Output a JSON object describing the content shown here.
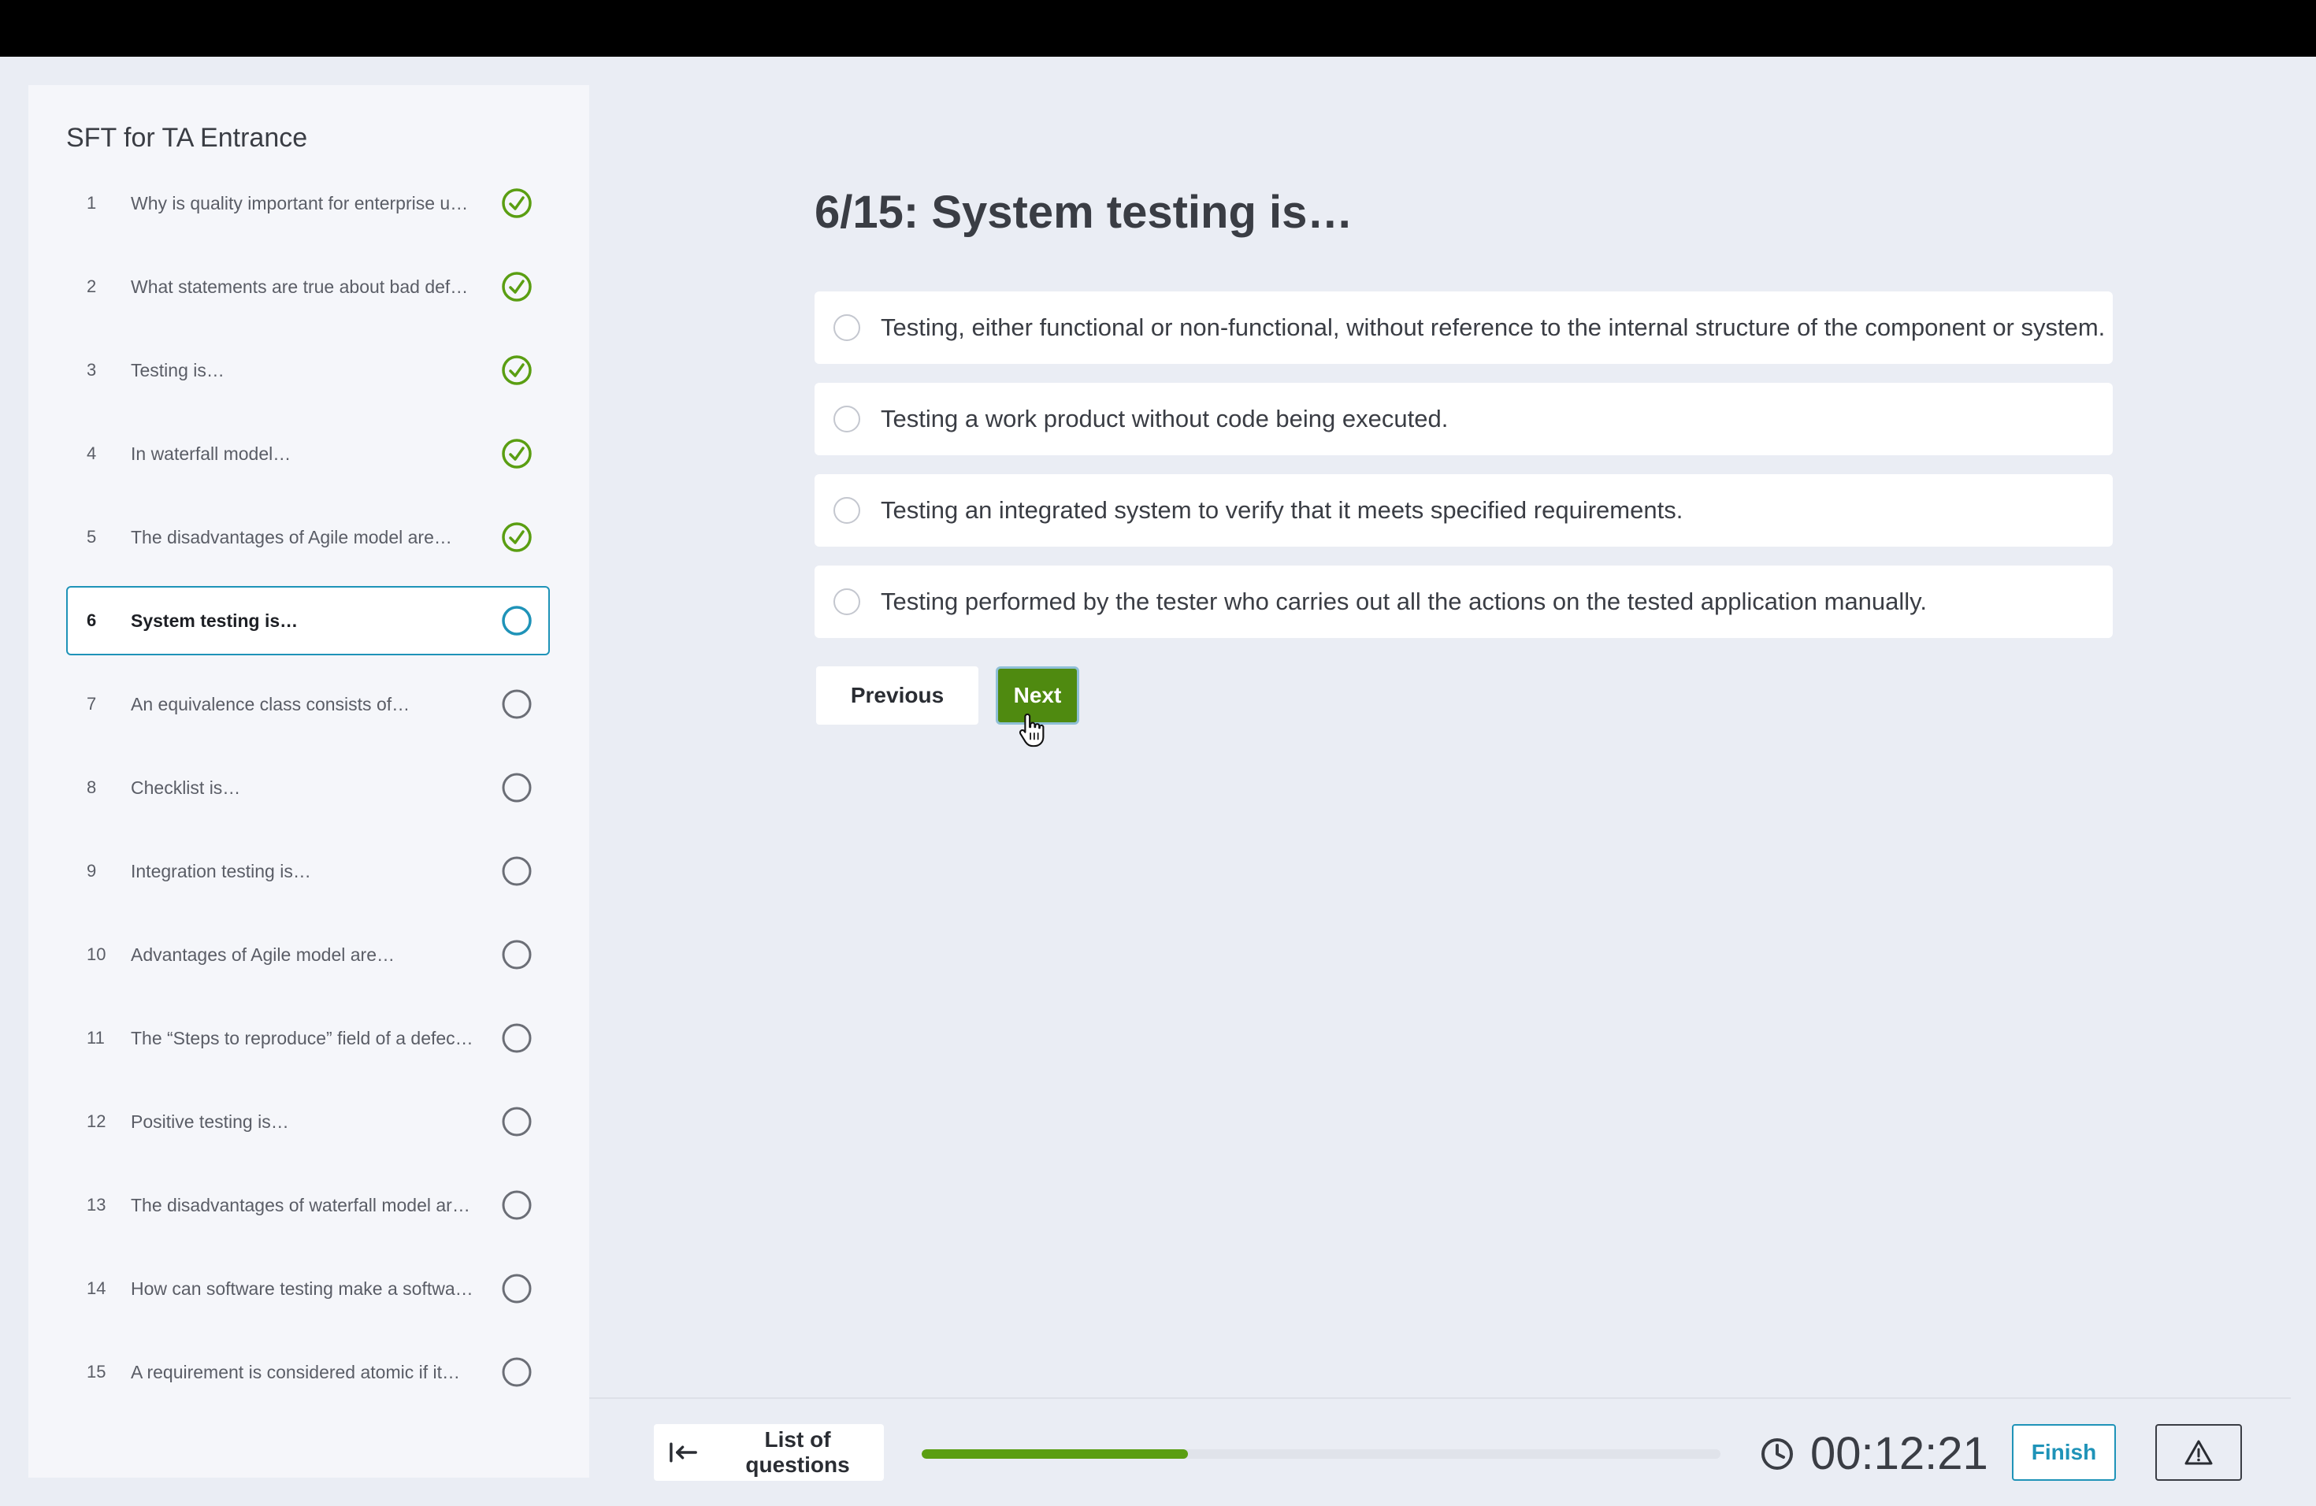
{
  "sidebar": {
    "title": "SFT for TA Entrance",
    "questions": [
      {
        "num": "1",
        "text": "Why is quality important for enterprise u…",
        "status": "answered"
      },
      {
        "num": "2",
        "text": "What statements are true about bad defe…",
        "status": "answered"
      },
      {
        "num": "3",
        "text": "Testing is…",
        "status": "answered"
      },
      {
        "num": "4",
        "text": "In waterfall model…",
        "status": "answered"
      },
      {
        "num": "5",
        "text": "The disadvantages of Agile model are…",
        "status": "answered"
      },
      {
        "num": "6",
        "text": "System testing is…",
        "status": "current"
      },
      {
        "num": "7",
        "text": "An equivalence class consists of…",
        "status": "unanswered"
      },
      {
        "num": "8",
        "text": "Checklist is…",
        "status": "unanswered"
      },
      {
        "num": "9",
        "text": "Integration testing is…",
        "status": "unanswered"
      },
      {
        "num": "10",
        "text": "Advantages of Agile model are…",
        "status": "unanswered"
      },
      {
        "num": "11",
        "text": "The “Steps to reproduce” field of a defec…",
        "status": "unanswered"
      },
      {
        "num": "12",
        "text": "Positive testing is…",
        "status": "unanswered"
      },
      {
        "num": "13",
        "text": "The disadvantages of waterfall model ar…",
        "status": "unanswered"
      },
      {
        "num": "14",
        "text": "How can software testing make a softwar…",
        "status": "unanswered"
      },
      {
        "num": "15",
        "text": "A requirement is considered atomic if it…",
        "status": "unanswered"
      }
    ]
  },
  "question": {
    "title": "6/15: System testing is…",
    "answers": [
      "Testing, either functional or non-functional, without reference to the internal structure of the component or system.",
      "Testing a work product without code being executed.",
      "Testing an integrated system to verify that it meets specified requirements.",
      "Testing performed by the tester who carries out all the actions on the tested application manually."
    ],
    "previous_label": "Previous",
    "next_label": "Next"
  },
  "footer": {
    "list_label": "List of questions",
    "progress_fraction": 0.333,
    "timer": "00:12:21",
    "finish_label": "Finish"
  },
  "colors": {
    "accent": "#1f93b8",
    "success": "#5a9e12",
    "next_button": "#4f8a10"
  },
  "icons": {
    "answered": "check-circle-icon",
    "current": "circle-outline-icon",
    "unanswered": "circle-outline-icon",
    "list": "collapse-left-icon",
    "timer": "clock-icon",
    "report": "warning-icon"
  }
}
